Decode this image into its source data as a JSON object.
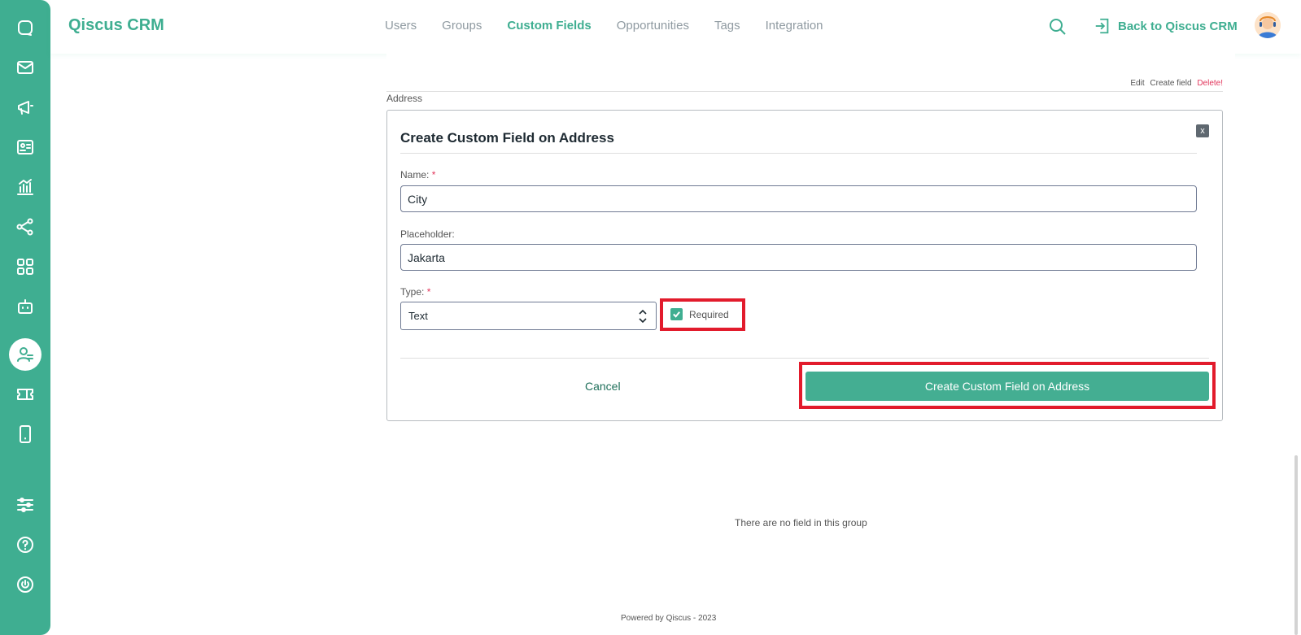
{
  "app": {
    "brand": "Qiscus CRM"
  },
  "nav": {
    "tabs": [
      {
        "label": "Users"
      },
      {
        "label": "Groups"
      },
      {
        "label": "Custom Fields"
      },
      {
        "label": "Opportunities"
      },
      {
        "label": "Tags"
      },
      {
        "label": "Integration"
      }
    ],
    "back_label": "Back to Qiscus CRM"
  },
  "sidebar": {
    "icons": [
      "chat-icon",
      "mail-icon",
      "megaphone-icon",
      "contact-card-icon",
      "analytics-icon",
      "share-nodes-icon",
      "apps-grid-icon",
      "robot-icon",
      "crm-user-icon",
      "ticket-icon",
      "mobile-icon",
      "settings-sliders-icon",
      "help-icon",
      "power-icon"
    ],
    "active": "crm-user-icon"
  },
  "group": {
    "name": "Address",
    "actions": {
      "edit": "Edit",
      "create": "Create field",
      "delete": "Delete!"
    }
  },
  "form": {
    "title": "Create Custom Field on Address",
    "close": "x",
    "name_label": "Name:",
    "name_value": "City",
    "placeholder_label": "Placeholder:",
    "placeholder_value": "Jakarta",
    "type_label": "Type:",
    "required_mark": "*",
    "type_value": "Text",
    "required_label": "Required",
    "required_checked": true,
    "cancel_label": "Cancel",
    "submit_label": "Create Custom Field on Address"
  },
  "empty_message": "There are no field in this group",
  "footer": "Powered by Qiscus - 2023",
  "colors": {
    "accent": "#3fae91",
    "highlight": "#e21b2c",
    "danger": "#e2365b"
  }
}
